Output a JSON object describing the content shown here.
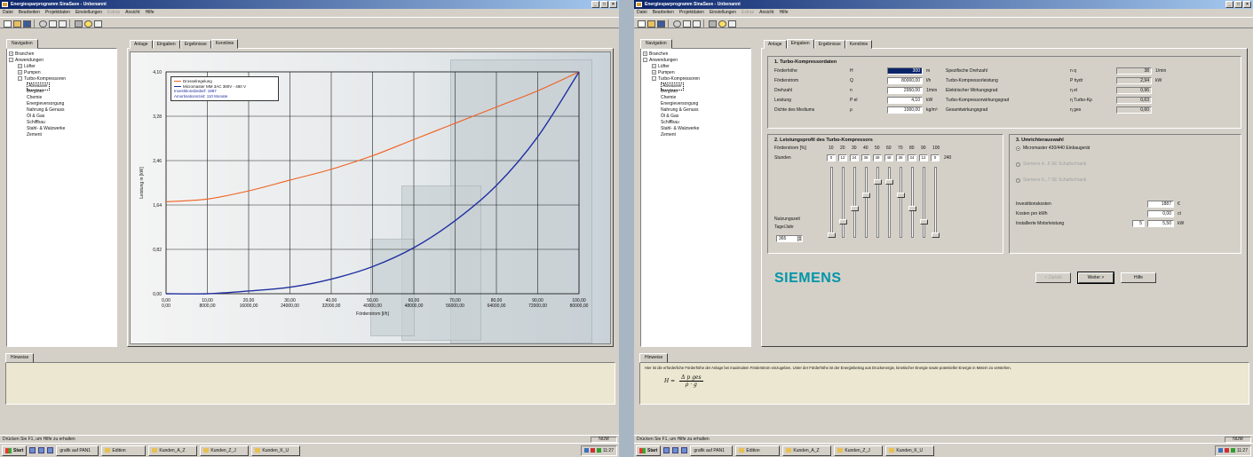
{
  "left": {
    "title": "Energiesparprogramm SinaSave - Unbenannt",
    "menu": [
      {
        "label": "Datei",
        "enabled": true
      },
      {
        "label": "Bearbeiten",
        "enabled": true
      },
      {
        "label": "Projektdaten",
        "enabled": true
      },
      {
        "label": "Einstellungen",
        "enabled": true
      },
      {
        "label": "Extras",
        "enabled": false
      },
      {
        "label": "Ansicht",
        "enabled": true
      },
      {
        "label": "Hilfe",
        "enabled": true
      }
    ],
    "nav_tab": "Navigation",
    "tree": [
      {
        "label": "Branchen",
        "level": 1,
        "expander": "+"
      },
      {
        "label": "Anwendungen",
        "level": 1,
        "expander": "-"
      },
      {
        "label": "Lüfter",
        "level": 2,
        "expander": "+"
      },
      {
        "label": "Pumpen",
        "level": 2,
        "expander": "+"
      },
      {
        "label": "Turbo-Kompressoren",
        "level": 2,
        "expander": "-"
      },
      {
        "label": "Abwasser",
        "level": 3,
        "selected": true
      },
      {
        "label": "Bergbau",
        "level": 3
      },
      {
        "label": "Chemie",
        "level": 3
      },
      {
        "label": "Energieversorgung",
        "level": 3
      },
      {
        "label": "Nahrung & Genuss",
        "level": 3
      },
      {
        "label": "Öl & Gas",
        "level": 3
      },
      {
        "label": "Schiffbau",
        "level": 3
      },
      {
        "label": "Stahl- & Walzwerke",
        "level": 3
      },
      {
        "label": "Zement",
        "level": 3
      }
    ],
    "tabs": [
      {
        "label": "Anlage",
        "active": false
      },
      {
        "label": "Eingaben",
        "active": false
      },
      {
        "label": "Ergebnisse",
        "active": false
      },
      {
        "label": "Kennlinie",
        "active": true
      }
    ],
    "hinweise_tab": "Hinweise",
    "status_text": "Drücken Sie F1, um Hilfe zu erhalten",
    "status_panel": "NUM",
    "taskbar": {
      "start": "Start",
      "items": [
        "grafik auf PAN1",
        "Edition",
        "Kunden_A_Z",
        "Kunden_Z_J",
        "Kunden_K_U"
      ],
      "clock": "11:27"
    }
  },
  "right": {
    "title": "Energiesparprogramm SinaSave - Unbenannt",
    "menu": [
      {
        "label": "Datei",
        "enabled": true
      },
      {
        "label": "Bearbeiten",
        "enabled": true
      },
      {
        "label": "Projektdaten",
        "enabled": true
      },
      {
        "label": "Einstellungen",
        "enabled": true
      },
      {
        "label": "Extras",
        "enabled": false
      },
      {
        "label": "Ansicht",
        "enabled": true
      },
      {
        "label": "Hilfe",
        "enabled": true
      }
    ],
    "nav_tab": "Navigation",
    "tree": [
      {
        "label": "Branchen",
        "level": 1,
        "expander": "+"
      },
      {
        "label": "Anwendungen",
        "level": 1,
        "expander": "-"
      },
      {
        "label": "Lüfter",
        "level": 2,
        "expander": "+"
      },
      {
        "label": "Pumpen",
        "level": 2,
        "expander": "+"
      },
      {
        "label": "Turbo-Kompressoren",
        "level": 2,
        "expander": "-"
      },
      {
        "label": "Abwasser",
        "level": 3,
        "selected": true
      },
      {
        "label": "Bergbau",
        "level": 3
      },
      {
        "label": "Chemie",
        "level": 3
      },
      {
        "label": "Energieversorgung",
        "level": 3
      },
      {
        "label": "Nahrung & Genuss",
        "level": 3
      },
      {
        "label": "Öl & Gas",
        "level": 3
      },
      {
        "label": "Schiffbau",
        "level": 3
      },
      {
        "label": "Stahl- & Walzwerke",
        "level": 3
      },
      {
        "label": "Zement",
        "level": 3
      }
    ],
    "tabs": [
      {
        "label": "Anlage",
        "active": false
      },
      {
        "label": "Eingaben",
        "active": true
      },
      {
        "label": "Ergebnisse",
        "active": false
      },
      {
        "label": "Kennlinie",
        "active": false
      }
    ],
    "section1": {
      "title": "1. Turbo-Kompressordaten",
      "rows_left": [
        {
          "label": "Förderhöhe",
          "symbol": "H",
          "value": "300",
          "unit": "m",
          "selected": true
        },
        {
          "label": "Förderstrom",
          "symbol": "Q",
          "value": "80000,00",
          "unit": "l/h"
        },
        {
          "label": "Drehzahl",
          "symbol": "n",
          "value": "2950,00",
          "unit": "1/min"
        },
        {
          "label": "Leistung",
          "symbol": "P el",
          "value": "4,10",
          "unit": "kW"
        },
        {
          "label": "Dichte des Mediums",
          "symbol": "ρ",
          "value": "1000,00",
          "unit": "kg/m³"
        }
      ],
      "rows_right": [
        {
          "label": "Spezifische Drehzahl",
          "symbol": "n q",
          "value": "38",
          "unit": "1/min"
        },
        {
          "label": "Turbo-Kompressorleistung",
          "symbol": "P hydr",
          "value": "2,94",
          "unit": "kW"
        },
        {
          "label": "Elektrischer Wirkungsgrad",
          "symbol": "η el",
          "value": "0,96",
          "unit": ""
        },
        {
          "label": "Turbo-Kompressorwirkungsgrad",
          "symbol": "η Turbo-Kp",
          "value": "0,63",
          "unit": ""
        },
        {
          "label": "Gesamtwirkungsgrad",
          "symbol": "η ges",
          "value": "0,60",
          "unit": ""
        }
      ]
    },
    "section2": {
      "title": "2. Leistungsprofil des Turbo-Kompressors",
      "row_label_1": "Förderstrom [%]",
      "row_label_2": "Stunden",
      "percents": [
        "10",
        "20",
        "30",
        "40",
        "50",
        "60",
        "70",
        "80",
        "90",
        "100"
      ],
      "hours": [
        "0",
        "12",
        "24",
        "36",
        "48",
        "48",
        "36",
        "24",
        "12",
        "0"
      ],
      "total_hours": "240",
      "label_nutzung": "Nutzungszeit",
      "label_tage": "Tage/Jahr",
      "days_value": "365"
    },
    "section3": {
      "title": "3. Umrichterauswahl",
      "options": [
        {
          "label": "Micromaster 430/440 Einbaugerät",
          "enabled": true,
          "checked": true
        },
        {
          "label": "Siemens 4...6 SE Schaltschrank",
          "enabled": false,
          "checked": false
        },
        {
          "label": "Siemens 6...7 SE Schaltschrank",
          "enabled": false,
          "checked": false
        }
      ],
      "fields": [
        {
          "label": "Investitionskosten",
          "value": "1887",
          "unit": "€"
        },
        {
          "label": "Kosten pro kWh",
          "value": "0,00",
          "unit": "ct"
        },
        {
          "label": "Installierte Motorleistung",
          "prefix": "5",
          "value": "5,50",
          "unit": "kW"
        }
      ]
    },
    "brand": "SIEMENS",
    "buttons": [
      {
        "label": "< Zurück",
        "enabled": false
      },
      {
        "label": "Weiter >",
        "enabled": true
      },
      {
        "label": "Hilfe",
        "enabled": true
      }
    ],
    "hinweise_tab": "Hinweise",
    "hinweise_text": "Hier ist die erforderliche Förderhöhe der Anlage bei maximalem Förderstrom einzugeben. Unter der Förderhöhe ist der Energiebetrag aus Druckenergie, kinetischer Energie sowie potentieller Energie in Metern zu verstehen.",
    "formula_lhs": "H =",
    "formula_num": "Δ p ges",
    "formula_den": "ρ · g",
    "status_text": "Drücken Sie F1, um Hilfe zu erhalten",
    "status_panel": "NUM",
    "taskbar": {
      "start": "Start",
      "items": [
        "grafik auf PAN1",
        "Edition",
        "Kunden_A_Z",
        "Kunden_Z_J",
        "Kunden_K_U"
      ],
      "clock": "11:27"
    }
  },
  "chart_data": {
    "type": "line",
    "xlabel": "Förderstrom [l/h]",
    "ylabel": "Leistung in [kW]",
    "xlim": [
      0,
      100
    ],
    "ylim": [
      0,
      4.1
    ],
    "x_ticks": [
      {
        "pct": "0,00",
        "abs": "0,00"
      },
      {
        "pct": "10,00",
        "abs": "8000,00"
      },
      {
        "pct": "20,00",
        "abs": "16000,00"
      },
      {
        "pct": "30,00",
        "abs": "24000,00"
      },
      {
        "pct": "40,00",
        "abs": "32000,00"
      },
      {
        "pct": "50,00",
        "abs": "40000,00"
      },
      {
        "pct": "60,00",
        "abs": "48000,00"
      },
      {
        "pct": "70,00",
        "abs": "56000,00"
      },
      {
        "pct": "80,00",
        "abs": "64000,00"
      },
      {
        "pct": "90,00",
        "abs": "72000,00"
      },
      {
        "pct": "100,00",
        "abs": "80000,00"
      }
    ],
    "y_ticks": [
      "0,00",
      "0,82",
      "1,64",
      "2,46",
      "3,28",
      "4,10"
    ],
    "x": [
      0,
      10,
      20,
      30,
      40,
      50,
      60,
      70,
      80,
      90,
      100
    ],
    "series": [
      {
        "name": "Drosselregelung",
        "color": "#f06020",
        "values": [
          1.7,
          1.75,
          1.9,
          2.1,
          2.3,
          2.55,
          2.85,
          3.15,
          3.45,
          3.75,
          4.1
        ]
      },
      {
        "name": "Micromaster MM 3AC 380V - 480 V",
        "color": "#2030a0",
        "values": [
          0.0,
          0.0,
          0.05,
          0.12,
          0.27,
          0.5,
          0.85,
          1.35,
          2.0,
          2.9,
          4.1
        ]
      }
    ],
    "legend_extra": [
      "Investitionsbedarf: 1887",
      "Amortisationszeit: 110 Monate"
    ],
    "legend_extra_color": "#2030a0",
    "grid": true,
    "legend": "top-left"
  }
}
